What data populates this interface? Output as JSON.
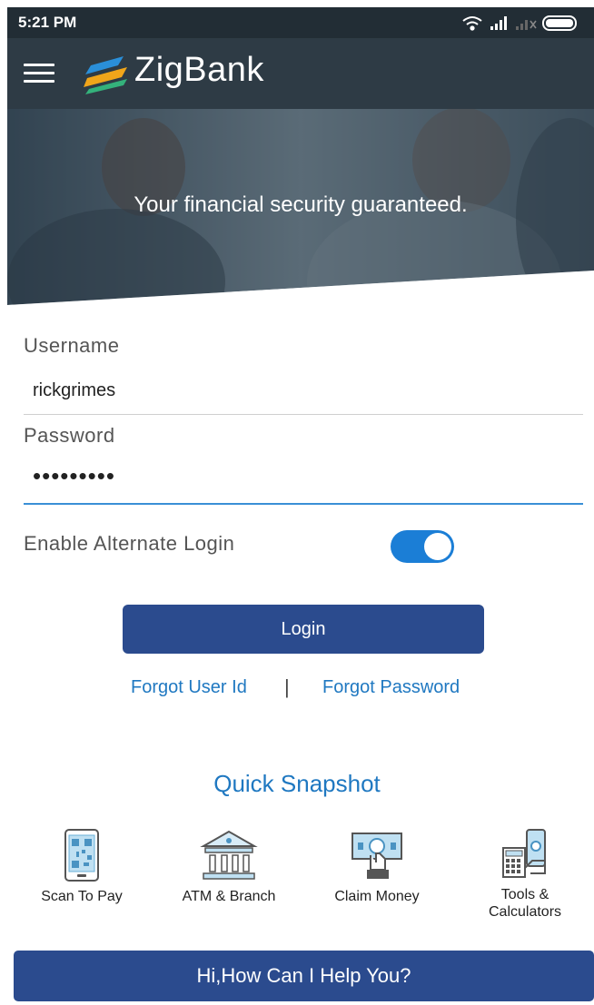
{
  "status_bar": {
    "time": "5:21 PM",
    "icons": [
      "wifi-icon",
      "signal-icon",
      "signal-no-sim-icon",
      "battery-icon"
    ]
  },
  "app_bar": {
    "brand_name": "ZigBank",
    "menu_icon": "hamburger-menu-icon"
  },
  "hero": {
    "tagline": "Your financial security guaranteed."
  },
  "login_form": {
    "username_label": "Username",
    "username_value": "rickgrimes",
    "password_label": "Password",
    "password_masked": "•••••••••",
    "alternate_login_label": "Enable Alternate Login",
    "alternate_login_enabled": true,
    "login_button": "Login",
    "forgot_user_id": "Forgot User Id",
    "separator": "|",
    "forgot_password": "Forgot Password"
  },
  "quick_snapshot": {
    "title": "Quick Snapshot",
    "items": [
      {
        "label": "Scan To Pay",
        "icon": "qr-phone-icon"
      },
      {
        "label": "ATM & Branch",
        "icon": "bank-building-icon"
      },
      {
        "label": "Claim Money",
        "icon": "money-hand-icon"
      },
      {
        "label": "Tools & Calculators",
        "icon": "calculator-icon"
      }
    ]
  },
  "help": {
    "label": "Hi,How Can I Help You?"
  },
  "colors": {
    "status_bar": "#222d35",
    "app_bar": "#2e3b45",
    "primary_button": "#2b4b8e",
    "link": "#1f78c1",
    "toggle_on": "#1b7ed6"
  }
}
